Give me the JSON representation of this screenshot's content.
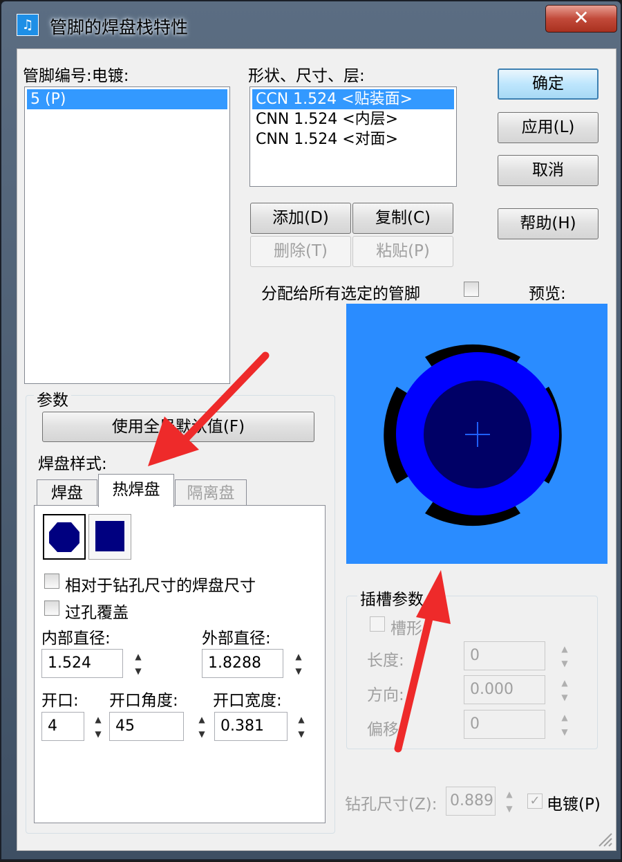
{
  "window": {
    "title": "管脚的焊盘栈特性",
    "close_icon": "✕"
  },
  "pin_list": {
    "label": "管脚编号:电镀:",
    "items": [
      "5 (P)"
    ]
  },
  "layers": {
    "label": "形状、尺寸、层:",
    "items": [
      "CCN 1.524 <贴装面>",
      "CNN 1.524 <内层>",
      "CNN 1.524 <对面>"
    ]
  },
  "buttons": {
    "ok": "确定",
    "apply": "应用(L)",
    "cancel": "取消",
    "help": "帮助(H)",
    "add": "添加(D)",
    "copy": "复制(C)",
    "delete": "删除(T)",
    "paste": "粘贴(P)"
  },
  "assign_all": {
    "label": "分配给所有选定的管脚",
    "checked": false
  },
  "preview": {
    "label": "预览:",
    "background": "#2a8cff",
    "pad_color": "#0000ff",
    "drill_color": "#000066",
    "spoke_color": "#000000"
  },
  "params": {
    "group_label": "参数",
    "use_defaults": "使用全局默认值(F)",
    "pad_style_label": "焊盘样式:",
    "tabs": [
      "焊盘",
      "热焊盘",
      "隔离盘"
    ],
    "active_tab": "热焊盘",
    "shape_icons": [
      "round-pad-icon",
      "square-pad-icon"
    ],
    "relative_to_drill": "相对于钻孔尺寸的焊盘尺寸",
    "via_tenting": "过孔覆盖",
    "inner_diameter_label": "内部直径:",
    "inner_diameter": "1.524",
    "outer_diameter_label": "外部直径:",
    "outer_diameter": "1.8288",
    "openings_label": "开口:",
    "openings": "4",
    "opening_angle_label": "开口角度:",
    "opening_angle": "45",
    "opening_width_label": "开口宽度:",
    "opening_width": "0.381"
  },
  "slot": {
    "group_label": "插槽参数",
    "slotted_label": "槽形",
    "length_label": "长度:",
    "length": "0",
    "orientation_label": "方向:",
    "orientation": "0.000",
    "offset_label": "偏移:",
    "offset": "0"
  },
  "drill": {
    "label": "钻孔尺寸(Z):",
    "value": "0.889",
    "plated_label": "电镀(P)",
    "plated": true
  },
  "annotation": {
    "arrow_color": "#ee2a2a"
  }
}
